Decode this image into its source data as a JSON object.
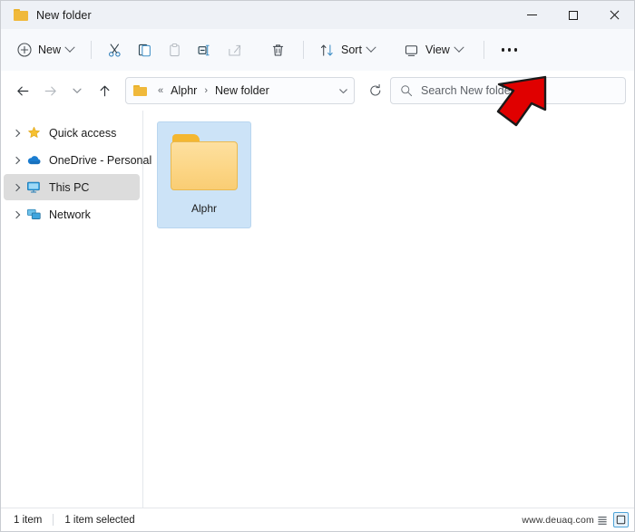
{
  "window": {
    "title": "New folder",
    "title_icon": "folder-icon",
    "controls": {
      "minimize": "minimize-icon",
      "maximize": "maximize-icon",
      "close": "close-icon"
    }
  },
  "toolbar": {
    "new_label": "New",
    "new_icon": "plus-circle-icon",
    "items": [
      {
        "name": "cut",
        "icon": "scissors-icon",
        "enabled": true
      },
      {
        "name": "copy",
        "icon": "copy-icon",
        "enabled": true
      },
      {
        "name": "paste",
        "icon": "clipboard-icon",
        "enabled": false
      },
      {
        "name": "rename",
        "icon": "rename-icon",
        "enabled": true
      },
      {
        "name": "share",
        "icon": "share-icon",
        "enabled": false
      },
      {
        "name": "delete",
        "icon": "trash-icon",
        "enabled": true
      }
    ],
    "sort_label": "Sort",
    "sort_icon": "sort-arrows-icon",
    "view_label": "View",
    "view_icon": "monitor-icon",
    "more_label": "See more",
    "more_icon": "ellipsis-icon"
  },
  "navigation": {
    "back_icon": "arrow-left-icon",
    "forward_icon": "arrow-right-icon",
    "recent_icon": "chevron-down-icon",
    "up_icon": "arrow-up-icon",
    "refresh_icon": "refresh-icon",
    "address": {
      "folder_icon": "folder-icon",
      "overflow": "«",
      "crumbs": [
        "Alphr",
        "New folder"
      ],
      "separator": "›",
      "dropdown_icon": "chevron-down-icon"
    }
  },
  "search": {
    "icon": "search-icon",
    "placeholder": "Search New folder",
    "value": ""
  },
  "sidebar": {
    "items": [
      {
        "label": "Quick access",
        "icon": "star-icon",
        "selected": false
      },
      {
        "label": "OneDrive - Personal",
        "icon": "cloud-icon",
        "selected": false
      },
      {
        "label": "This PC",
        "icon": "monitor-icon",
        "selected": true
      },
      {
        "label": "Network",
        "icon": "network-icon",
        "selected": false
      }
    ]
  },
  "content": {
    "files": [
      {
        "name": "Alphr",
        "type": "folder",
        "icon": "folder-icon",
        "selected": true
      }
    ]
  },
  "statusbar": {
    "item_count": "1 item",
    "selection": "1 item selected",
    "watermark": "www.deuaq.com",
    "view_details_icon": "details-view-icon",
    "view_large_icon": "large-icons-view-icon"
  },
  "annotation": {
    "arrow_color": "#e00000",
    "arrow_outline": "#1a1a1a",
    "points_at": "See more (...) button"
  }
}
